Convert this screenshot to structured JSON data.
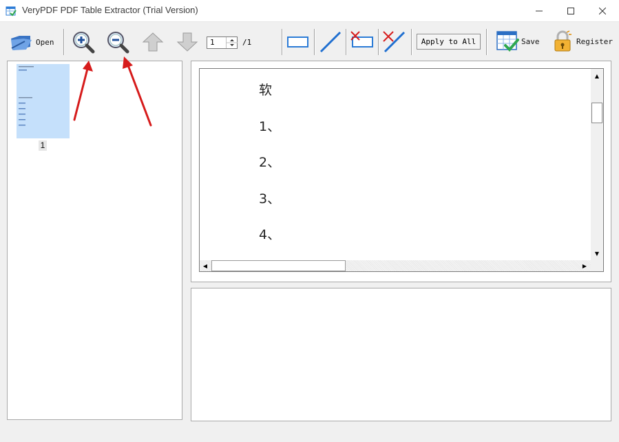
{
  "window": {
    "title": "VeryPDF PDF Table Extractor (Trial Version)",
    "minimize_glyph": "—",
    "maximize_glyph": "☐",
    "close_glyph": "✕"
  },
  "toolbar": {
    "open_label": "Open",
    "zoom_in_icon": "zoom-in-icon",
    "zoom_out_icon": "zoom-out-icon",
    "prev_page_icon": "arrow-up-icon",
    "next_page_icon": "arrow-down-icon",
    "page_value": "1",
    "page_total": "/1",
    "apply_to_all_label": "Apply to All",
    "save_label": "Save",
    "register_label": "Register"
  },
  "thumbnails": {
    "items": [
      {
        "page_number": "1"
      }
    ]
  },
  "document_view": {
    "lines": [
      "软",
      "1、",
      "2、",
      "3、",
      "4、"
    ]
  },
  "colors": {
    "accent_blue": "#1f6fd0",
    "annotation_red": "#d61b1b",
    "thumbnail_fill": "#c5e0fb"
  }
}
